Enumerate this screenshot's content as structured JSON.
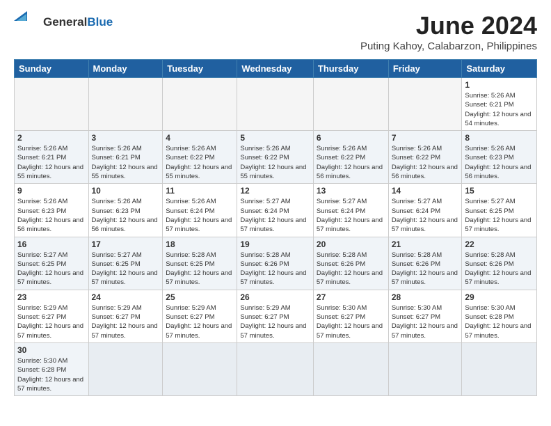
{
  "header": {
    "logo_general": "General",
    "logo_blue": "Blue",
    "title": "June 2024",
    "subtitle": "Puting Kahoy, Calabarzon, Philippines"
  },
  "days_of_week": [
    "Sunday",
    "Monday",
    "Tuesday",
    "Wednesday",
    "Thursday",
    "Friday",
    "Saturday"
  ],
  "weeks": [
    {
      "cells": [
        {
          "day": "",
          "info": ""
        },
        {
          "day": "",
          "info": ""
        },
        {
          "day": "",
          "info": ""
        },
        {
          "day": "",
          "info": ""
        },
        {
          "day": "",
          "info": ""
        },
        {
          "day": "",
          "info": ""
        },
        {
          "day": "1",
          "info": "Sunrise: 5:26 AM\nSunset: 6:21 PM\nDaylight: 12 hours and 54 minutes."
        }
      ]
    },
    {
      "cells": [
        {
          "day": "2",
          "info": "Sunrise: 5:26 AM\nSunset: 6:21 PM\nDaylight: 12 hours and 55 minutes."
        },
        {
          "day": "3",
          "info": "Sunrise: 5:26 AM\nSunset: 6:21 PM\nDaylight: 12 hours and 55 minutes."
        },
        {
          "day": "4",
          "info": "Sunrise: 5:26 AM\nSunset: 6:22 PM\nDaylight: 12 hours and 55 minutes."
        },
        {
          "day": "5",
          "info": "Sunrise: 5:26 AM\nSunset: 6:22 PM\nDaylight: 12 hours and 55 minutes."
        },
        {
          "day": "6",
          "info": "Sunrise: 5:26 AM\nSunset: 6:22 PM\nDaylight: 12 hours and 56 minutes."
        },
        {
          "day": "7",
          "info": "Sunrise: 5:26 AM\nSunset: 6:22 PM\nDaylight: 12 hours and 56 minutes."
        },
        {
          "day": "8",
          "info": "Sunrise: 5:26 AM\nSunset: 6:23 PM\nDaylight: 12 hours and 56 minutes."
        }
      ]
    },
    {
      "cells": [
        {
          "day": "9",
          "info": "Sunrise: 5:26 AM\nSunset: 6:23 PM\nDaylight: 12 hours and 56 minutes."
        },
        {
          "day": "10",
          "info": "Sunrise: 5:26 AM\nSunset: 6:23 PM\nDaylight: 12 hours and 56 minutes."
        },
        {
          "day": "11",
          "info": "Sunrise: 5:26 AM\nSunset: 6:24 PM\nDaylight: 12 hours and 57 minutes."
        },
        {
          "day": "12",
          "info": "Sunrise: 5:27 AM\nSunset: 6:24 PM\nDaylight: 12 hours and 57 minutes."
        },
        {
          "day": "13",
          "info": "Sunrise: 5:27 AM\nSunset: 6:24 PM\nDaylight: 12 hours and 57 minutes."
        },
        {
          "day": "14",
          "info": "Sunrise: 5:27 AM\nSunset: 6:24 PM\nDaylight: 12 hours and 57 minutes."
        },
        {
          "day": "15",
          "info": "Sunrise: 5:27 AM\nSunset: 6:25 PM\nDaylight: 12 hours and 57 minutes."
        }
      ]
    },
    {
      "cells": [
        {
          "day": "16",
          "info": "Sunrise: 5:27 AM\nSunset: 6:25 PM\nDaylight: 12 hours and 57 minutes."
        },
        {
          "day": "17",
          "info": "Sunrise: 5:27 AM\nSunset: 6:25 PM\nDaylight: 12 hours and 57 minutes."
        },
        {
          "day": "18",
          "info": "Sunrise: 5:28 AM\nSunset: 6:25 PM\nDaylight: 12 hours and 57 minutes."
        },
        {
          "day": "19",
          "info": "Sunrise: 5:28 AM\nSunset: 6:26 PM\nDaylight: 12 hours and 57 minutes."
        },
        {
          "day": "20",
          "info": "Sunrise: 5:28 AM\nSunset: 6:26 PM\nDaylight: 12 hours and 57 minutes."
        },
        {
          "day": "21",
          "info": "Sunrise: 5:28 AM\nSunset: 6:26 PM\nDaylight: 12 hours and 57 minutes."
        },
        {
          "day": "22",
          "info": "Sunrise: 5:28 AM\nSunset: 6:26 PM\nDaylight: 12 hours and 57 minutes."
        }
      ]
    },
    {
      "cells": [
        {
          "day": "23",
          "info": "Sunrise: 5:29 AM\nSunset: 6:27 PM\nDaylight: 12 hours and 57 minutes."
        },
        {
          "day": "24",
          "info": "Sunrise: 5:29 AM\nSunset: 6:27 PM\nDaylight: 12 hours and 57 minutes."
        },
        {
          "day": "25",
          "info": "Sunrise: 5:29 AM\nSunset: 6:27 PM\nDaylight: 12 hours and 57 minutes."
        },
        {
          "day": "26",
          "info": "Sunrise: 5:29 AM\nSunset: 6:27 PM\nDaylight: 12 hours and 57 minutes."
        },
        {
          "day": "27",
          "info": "Sunrise: 5:30 AM\nSunset: 6:27 PM\nDaylight: 12 hours and 57 minutes."
        },
        {
          "day": "28",
          "info": "Sunrise: 5:30 AM\nSunset: 6:27 PM\nDaylight: 12 hours and 57 minutes."
        },
        {
          "day": "29",
          "info": "Sunrise: 5:30 AM\nSunset: 6:28 PM\nDaylight: 12 hours and 57 minutes."
        }
      ]
    },
    {
      "cells": [
        {
          "day": "30",
          "info": "Sunrise: 5:30 AM\nSunset: 6:28 PM\nDaylight: 12 hours and 57 minutes."
        },
        {
          "day": "",
          "info": ""
        },
        {
          "day": "",
          "info": ""
        },
        {
          "day": "",
          "info": ""
        },
        {
          "day": "",
          "info": ""
        },
        {
          "day": "",
          "info": ""
        },
        {
          "day": "",
          "info": ""
        }
      ]
    }
  ]
}
